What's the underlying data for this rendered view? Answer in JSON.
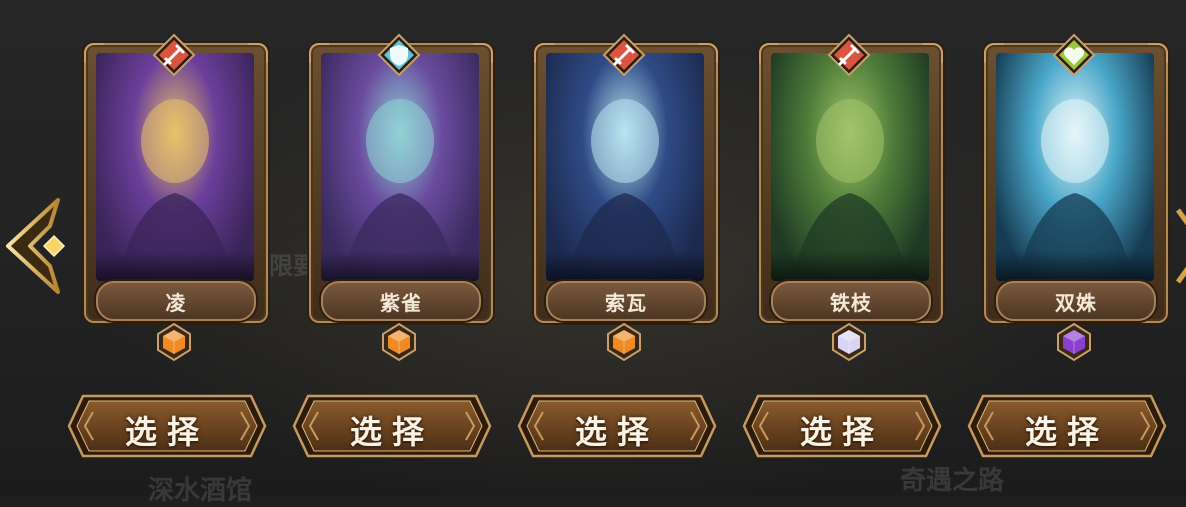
{
  "heroes": [
    {
      "name": "凌",
      "class_icon": "sword-icon",
      "class_color": "#d9553f",
      "rarity_icon": "orange-gem-icon",
      "rarity_color": "#f08a22",
      "portrait_colors": [
        "#3a2458",
        "#6b3f9a",
        "#e8c26a"
      ]
    },
    {
      "name": "紫雀",
      "class_icon": "shield-icon",
      "class_color": "#5fc4d8",
      "rarity_icon": "orange-gem-icon",
      "rarity_color": "#f08a22",
      "portrait_colors": [
        "#3a2a5e",
        "#6a4b9e",
        "#8fd3d6"
      ]
    },
    {
      "name": "索瓦",
      "class_icon": "sword-icon",
      "class_color": "#d9553f",
      "rarity_icon": "orange-gem-icon",
      "rarity_color": "#f08a22",
      "portrait_colors": [
        "#1d2a4f",
        "#2f4b86",
        "#b9e4f0"
      ]
    },
    {
      "name": "铁枝",
      "class_icon": "sword-icon",
      "class_color": "#d9553f",
      "rarity_icon": "white-gem-icon",
      "rarity_color": "#d9d4f2",
      "portrait_colors": [
        "#1f3a24",
        "#4f7d3a",
        "#a3c46a"
      ]
    },
    {
      "name": "双姝",
      "class_icon": "heart-icon",
      "class_color": "#9ac63c",
      "rarity_icon": "purple-gem-icon",
      "rarity_color": "#8a3fd0",
      "portrait_colors": [
        "#163b52",
        "#4aa7c9",
        "#e6f6fa"
      ]
    }
  ],
  "select_label": "选择",
  "background_texts": {
    "upper": "无限要",
    "bottom_left": "深水酒馆",
    "bottom_right": "奇遇之路"
  },
  "nav": {
    "left_arrow_icon": "chevron-left-icon",
    "right_arrow_icon": "chevron-right-icon"
  },
  "colors": {
    "button_fill": "#6b4322",
    "button_border": "#b88a55",
    "frame_border": "#b08a57"
  }
}
